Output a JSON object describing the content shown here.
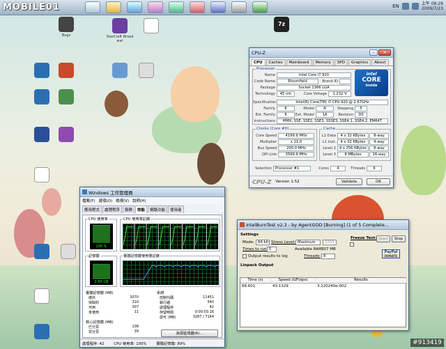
{
  "brand": "MOBILE01",
  "taskbar": {
    "icons": [
      "wallpaper-app-icon",
      "folder-icon",
      "globe-icon",
      "anime-avatar-icon",
      "anime-avatar-icon",
      "anime-avatar-icon",
      "media-icon",
      "chess-icon",
      "window-icon"
    ],
    "lang": "EN",
    "clock_time": "上午 08:29",
    "clock_date": "2009/7/23"
  },
  "desktop_icons": [
    {
      "label": "Bugs",
      "color": "#444444"
    },
    {
      "label": "StarCraft Broodwar",
      "color": "#6b3fa0"
    },
    {
      "label": "",
      "color": "#ffffff"
    },
    {
      "label": "7z",
      "color": "#222222"
    },
    {
      "label": "",
      "color": "#2b6fb3"
    },
    {
      "label": "",
      "color": "#c84a2c"
    },
    {
      "label": "",
      "color": "#6a9bd0"
    },
    {
      "label": "",
      "color": "#dddddd"
    },
    {
      "label": "",
      "color": "#2b6fb3"
    },
    {
      "label": "",
      "color": "#4d8f4d"
    },
    {
      "label": "",
      "color": "#2a4f99"
    },
    {
      "label": "",
      "color": "#8e4cb0"
    },
    {
      "label": "",
      "color": "#ffffff"
    },
    {
      "label": "",
      "color": "#2b6fb3"
    },
    {
      "label": "",
      "color": "#dddddd"
    },
    {
      "label": "",
      "color": "#ffffff"
    },
    {
      "label": "",
      "color": "#2b6fb3"
    }
  ],
  "cpuz": {
    "title": "CPU-Z",
    "tabs": [
      "CPU",
      "Caches",
      "Mainboard",
      "Memory",
      "SPD",
      "Graphics",
      "About"
    ],
    "processor_group": "Processor",
    "name_label": "Name",
    "name": "Intel Core i7 920",
    "codename_label": "Code Name",
    "codename": "Bloomfield",
    "brandid_label": "Brand ID",
    "package_label": "Package",
    "package": "Socket 1366 LGA",
    "technology_label": "Technology",
    "technology": "45 nm",
    "core_voltage_label": "Core Voltage",
    "core_voltage": "1.232 V",
    "spec_label": "Specification",
    "specification": "Intel(R) Core(TM) i7 CPU   920 @ 2.67GHz",
    "family_label": "Family",
    "family": "6",
    "model_label": "Model",
    "model": "A",
    "stepping_label": "Stepping",
    "stepping": "5",
    "extfamily_label": "Ext. Family",
    "ext_family": "6",
    "extmodel_label": "Ext. Model",
    "ext_model": "1A",
    "revision_label": "Revision",
    "revision": "D0",
    "instr_label": "Instructions",
    "instructions": "MMX, SSE, SSE2, SSE3, SSSE3, SSE4.1, SSE4.2, EM64T",
    "clocks_group": "Clocks (Core #0)",
    "core_speed_label": "Core Speed",
    "core_speed": "4199.9 MHz",
    "multiplier_label": "Multiplier",
    "multiplier": "x 21.0",
    "bus_speed_label": "Bus Speed",
    "bus_speed": "200.0 MHz",
    "qpi_label": "QPI Link",
    "qpi": "3599.9 MHz",
    "cache_group": "Cache",
    "l1d_label": "L1 Data",
    "l1d": "4 x 32 KBytes",
    "l1d_way": "8-way",
    "l1i_label": "L1 Inst.",
    "l1i": "4 x 32 KBytes",
    "l1i_way": "4-way",
    "l2_label": "Level 2",
    "l2": "4 x 256 KBytes",
    "l2_way": "8-way",
    "l3_label": "Level 3",
    "l3": "8 MBytes",
    "l3_way": "16-way",
    "selection_label": "Selection",
    "selection": "Processor #1",
    "cores_label": "Cores",
    "cores": "4",
    "threads_label": "Threads",
    "threads": "8",
    "logo": "CPU-Z",
    "version": "Version 1.52",
    "validate": "Validate",
    "ok": "OK",
    "intel_badge_brand": "intel",
    "intel_badge_line1": "CORE",
    "intel_badge_line2": "inside"
  },
  "taskmgr": {
    "title": "Windows 工作管理員",
    "menu": [
      "檔案(F)",
      "選項(O)",
      "檢視(V)",
      "說明(H)"
    ],
    "tabs": [
      "應用程式",
      "處理程序",
      "服務",
      "效能",
      "網路功能",
      "使用者"
    ],
    "cpu_usage_label": "CPU 使用率",
    "cpu_history_label": "CPU 使用率記錄",
    "cpu_usage": "100 %",
    "cpu_usage_fraction": 1.0,
    "mem_label": "記憶體",
    "mem_history_label": "實體記憶體使用量記錄",
    "mem_usage": "2.69 GB",
    "mem_usage_fraction": 0.89,
    "phys_mem_label": "實體記憶體 (MB)",
    "phys_mem": [
      {
        "k": "總共",
        "v": "3070"
      },
      {
        "k": "快取的",
        "v": "310"
      },
      {
        "k": "可用",
        "v": "307"
      },
      {
        "k": "未使用",
        "v": "11"
      }
    ],
    "system_label": "系統",
    "system": [
      {
        "k": "控制代碼",
        "v": "11451"
      },
      {
        "k": "執行緒",
        "v": "540"
      },
      {
        "k": "處理程序",
        "v": "42"
      },
      {
        "k": "存留時間",
        "v": "0:00:03:16"
      },
      {
        "k": "認可 (MB)",
        "v": "3287 / 7164"
      }
    ],
    "kernel_label": "核心記憶體 (MB)",
    "kernel": [
      {
        "k": "已分頁",
        "v": "108"
      },
      {
        "k": "非分頁",
        "v": "39"
      }
    ],
    "resource_button": "資源監視器(R)...",
    "status_processes": "處理程序: 42",
    "status_cpu": "CPU 使用率: 100%",
    "status_mem": "實體記憶體: 89%"
  },
  "ibt": {
    "title": "IntelBurnTest v2.3 - by AgentGOD [Burning] (1 of 5 Complete...",
    "settings_label": "Settings",
    "mode_label": "Mode:",
    "mode": "64-bit",
    "stress_label": "Stress Level:",
    "stress": "Maximum",
    "stress_value": "2203",
    "times_label": "Times to run:",
    "times": "5",
    "avail_ram_label": "Available RAM:",
    "avail_ram": "307 MB",
    "output_label": "Output results to log",
    "threads_label": "Threads:",
    "threads": "8",
    "freeze_label": "Freeze Test:",
    "start": "Start",
    "stop": "Stop",
    "paypal": "PayPal",
    "donate": "DONATE",
    "linpack_label": "Linpack Output",
    "col_time": "Time (s)",
    "col_speed": "Speed (GFlops)",
    "col_results": "Results",
    "row_time": "68.601",
    "row_speed": "43.1329",
    "row_result": "3.120240e-002"
  },
  "watermark": "#913419"
}
